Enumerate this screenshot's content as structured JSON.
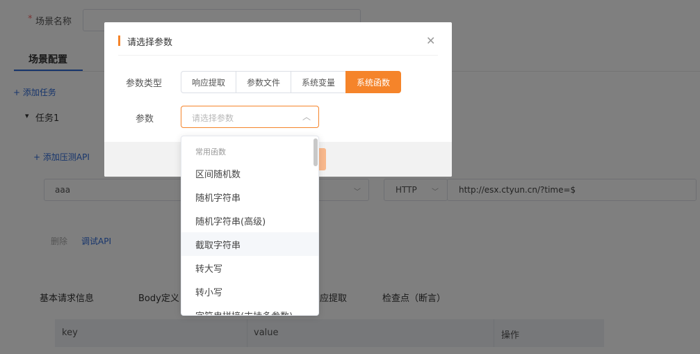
{
  "background": {
    "scene_name_required": "*",
    "scene_name_label": "场景名称",
    "tab_scene_config": "场景配置",
    "add_task": "+ 添加任务",
    "task_toggle": "▾",
    "task_name": "任务1",
    "add_api": "+ 添加压测API",
    "api_name_value": "aaa",
    "protocol_value": "HTTP",
    "url_value": "http://esx.ctyun.cn/?time=$",
    "delete_label": "删除",
    "debug_api_label": "调试API",
    "subtabs": [
      "基本请求信息",
      "Body定义",
      "应提取",
      "检查点（断言）"
    ],
    "table_headers": [
      "key",
      "value",
      "操作"
    ]
  },
  "dialog": {
    "title": "请选择参数",
    "close_icon": "close-icon",
    "param_type_label": "参数类型",
    "param_types": [
      {
        "label": "响应提取",
        "active": false
      },
      {
        "label": "参数文件",
        "active": false
      },
      {
        "label": "系统变量",
        "active": false
      },
      {
        "label": "系统函数",
        "active": true
      }
    ],
    "param_label": "参数",
    "param_placeholder": "请选择参数",
    "accent_color": "#f5842a"
  },
  "dropdown": {
    "group_label": "常用函数",
    "items": [
      "区间随机数",
      "随机字符串",
      "随机字符串(高级)",
      "截取字符串",
      "转大写",
      "转小写",
      "字符串拼接(支持多参数)"
    ],
    "hovered_item": "截取字符串"
  }
}
